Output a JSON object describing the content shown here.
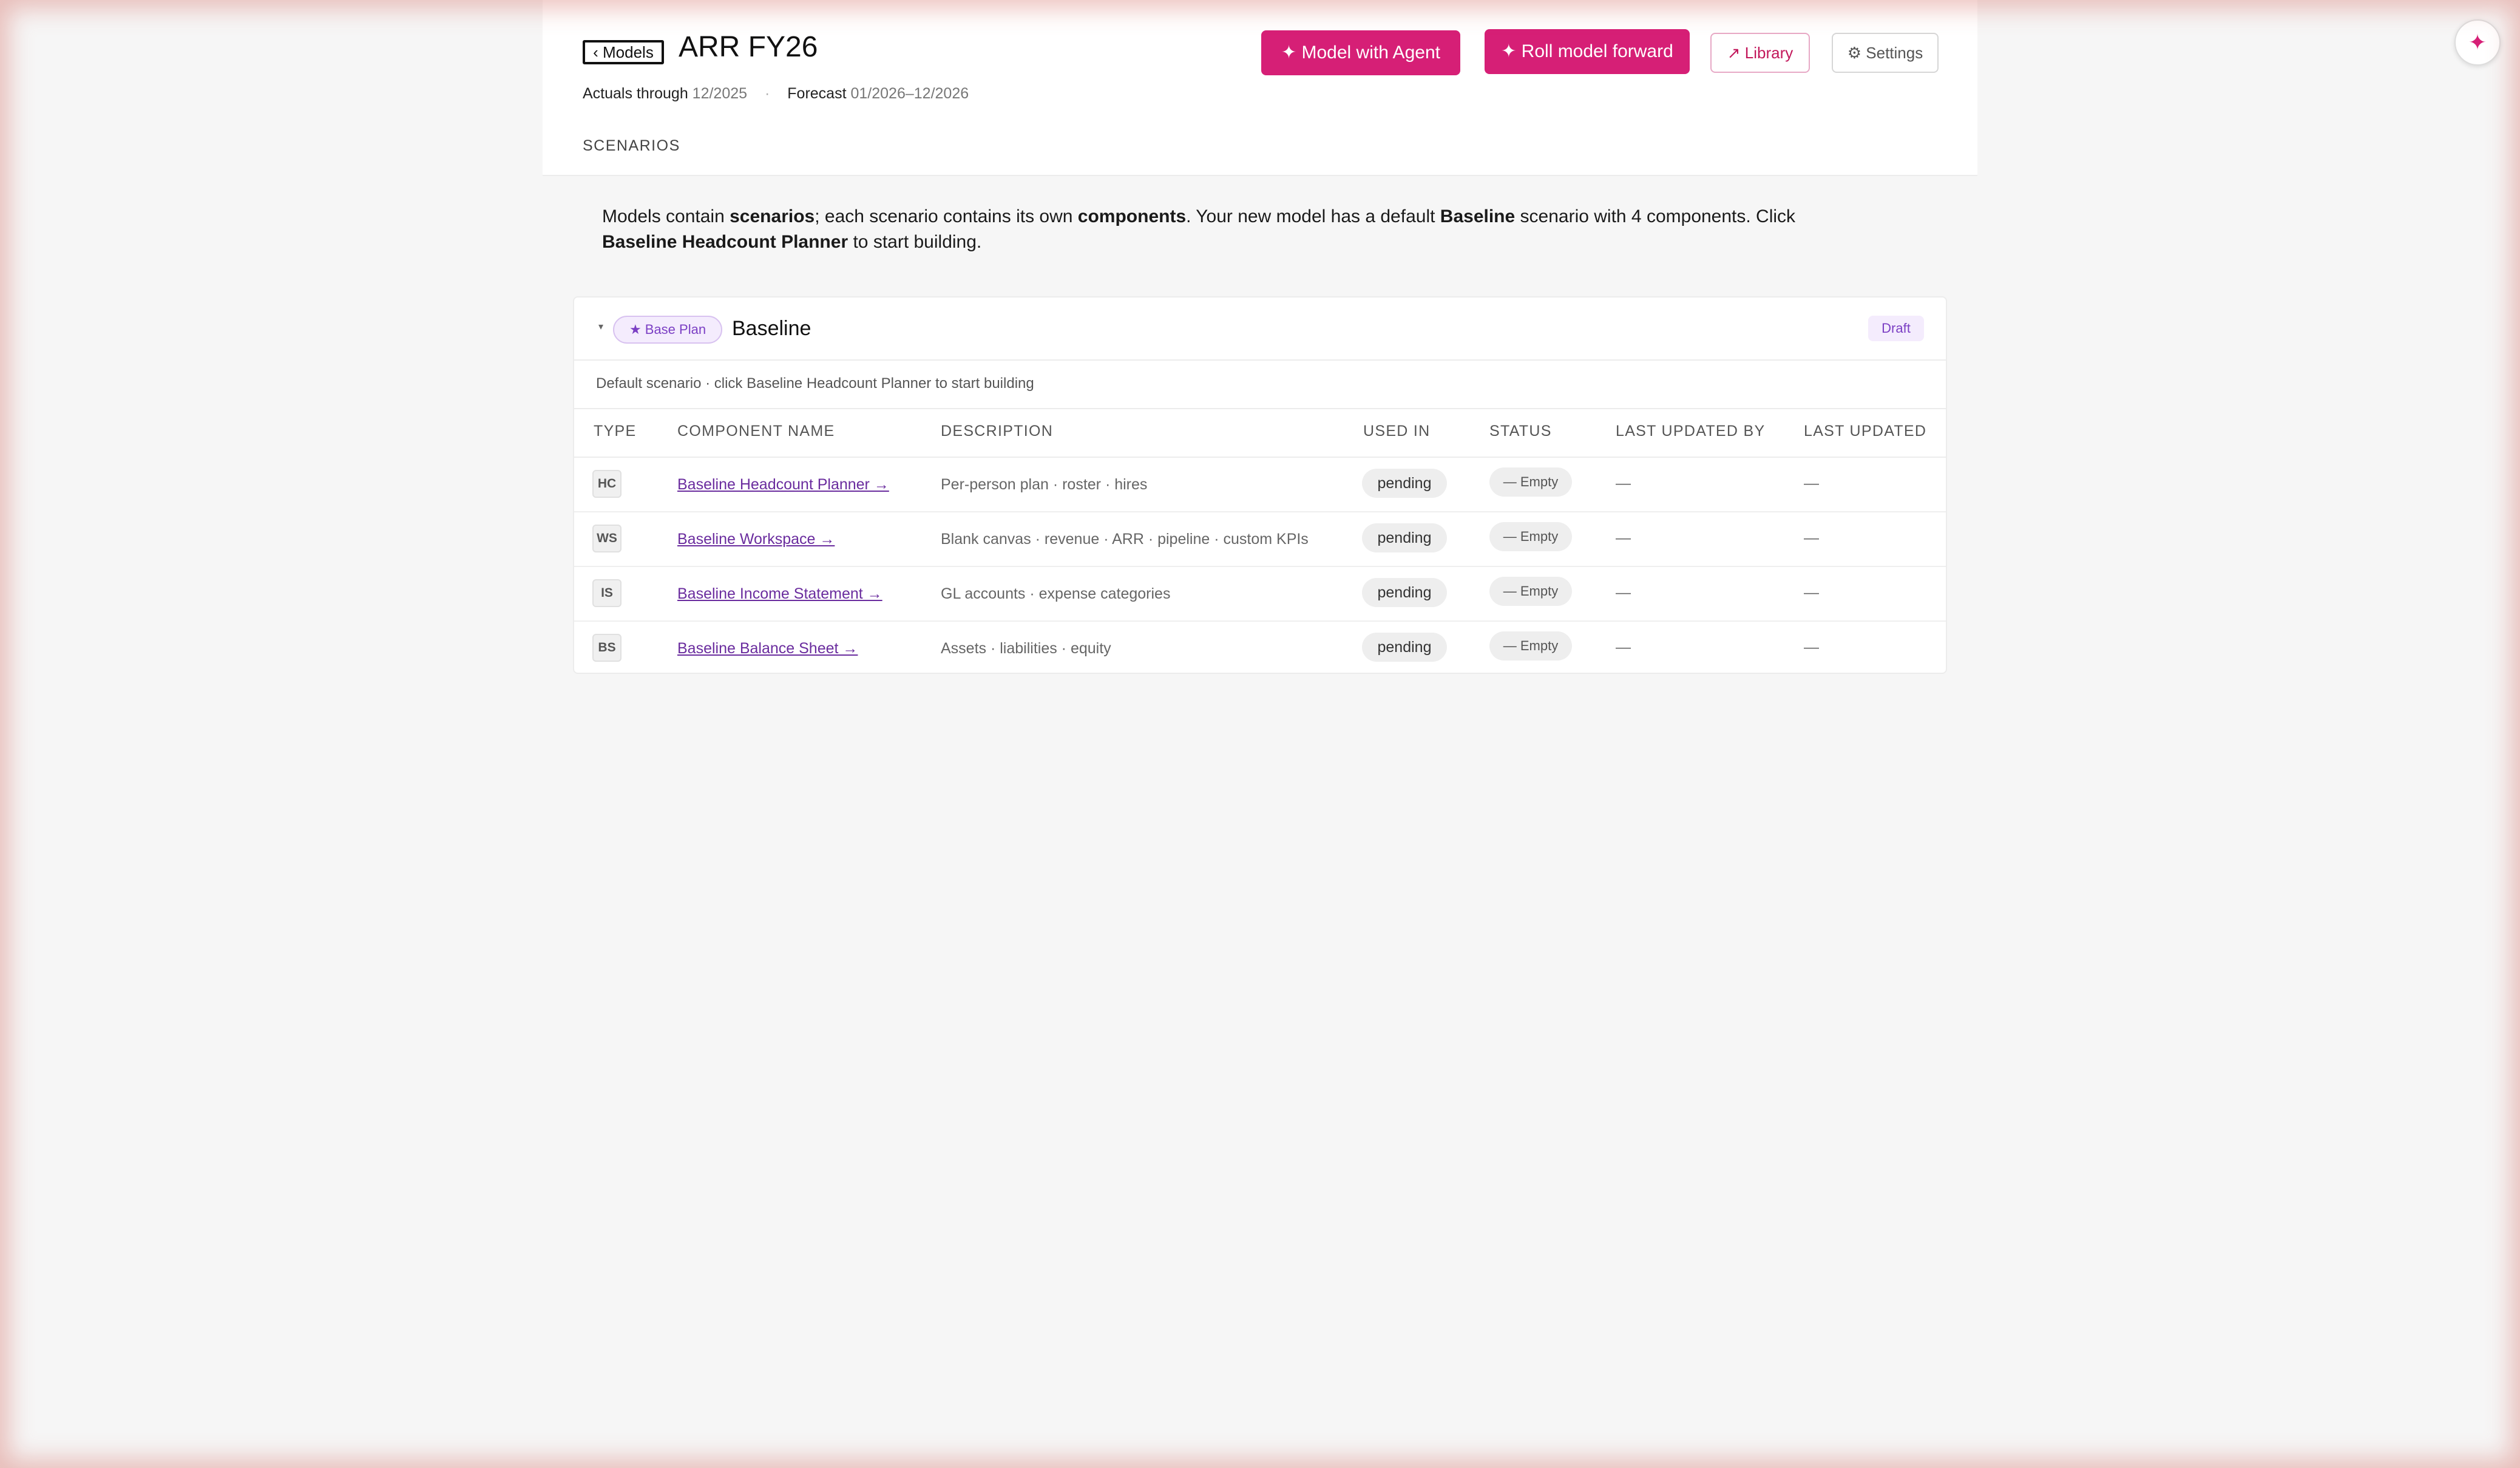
{
  "header": {
    "back_label": "‹ Models",
    "title": "ARR FY26",
    "actuals_label": "Actuals through",
    "actuals_value": "12/2025",
    "separator": "·",
    "forecast_label": "Forecast",
    "forecast_value": "01/2026–12/2026",
    "section_label": "SCENARIOS",
    "buttons": {
      "agent": "✦ Model with Agent",
      "roll": "✦ Roll model forward",
      "library": "↗ Library",
      "settings": "⚙ Settings"
    },
    "fab_icon": "✦"
  },
  "intro": {
    "t1": "Models contain ",
    "b1": "scenarios",
    "t2": "; each scenario contains its own ",
    "b2": "components",
    "t3": ". Your new model has a default ",
    "b3": "Baseline",
    "t4": " scenario with 4 components. Click ",
    "b4": "Baseline Headcount Planner",
    "t5": " to start building."
  },
  "scenario": {
    "caret": "▾",
    "badge": "★ Base Plan",
    "name": "Baseline",
    "status_badge": "Draft",
    "subtitle": "Default scenario · click Baseline Headcount Planner to start building",
    "columns": [
      "TYPE",
      "COMPONENT NAME",
      "DESCRIPTION",
      "USED IN",
      "STATUS",
      "LAST UPDATED BY",
      "LAST UPDATED"
    ],
    "rows": [
      {
        "type": "HC",
        "name": "Baseline Headcount Planner →",
        "description": "Per-person plan · roster · hires",
        "used_in": "pending",
        "status": "— Empty",
        "updated_by": "—",
        "updated": "—"
      },
      {
        "type": "WS",
        "name": "Baseline Workspace →",
        "description": "Blank canvas · revenue · ARR · pipeline · custom KPIs",
        "used_in": "pending",
        "status": "— Empty",
        "updated_by": "—",
        "updated": "—"
      },
      {
        "type": "IS",
        "name": "Baseline Income Statement →",
        "description": "GL accounts · expense categories",
        "used_in": "pending",
        "status": "— Empty",
        "updated_by": "—",
        "updated": "—"
      },
      {
        "type": "BS",
        "name": "Baseline Balance Sheet →",
        "description": "Assets · liabilities · equity",
        "used_in": "pending",
        "status": "— Empty",
        "updated_by": "—",
        "updated": "—"
      }
    ]
  },
  "colors": {
    "accent": "#d61f76",
    "link": "#6a2c9e",
    "badge_bg": "#f4ecfd"
  }
}
